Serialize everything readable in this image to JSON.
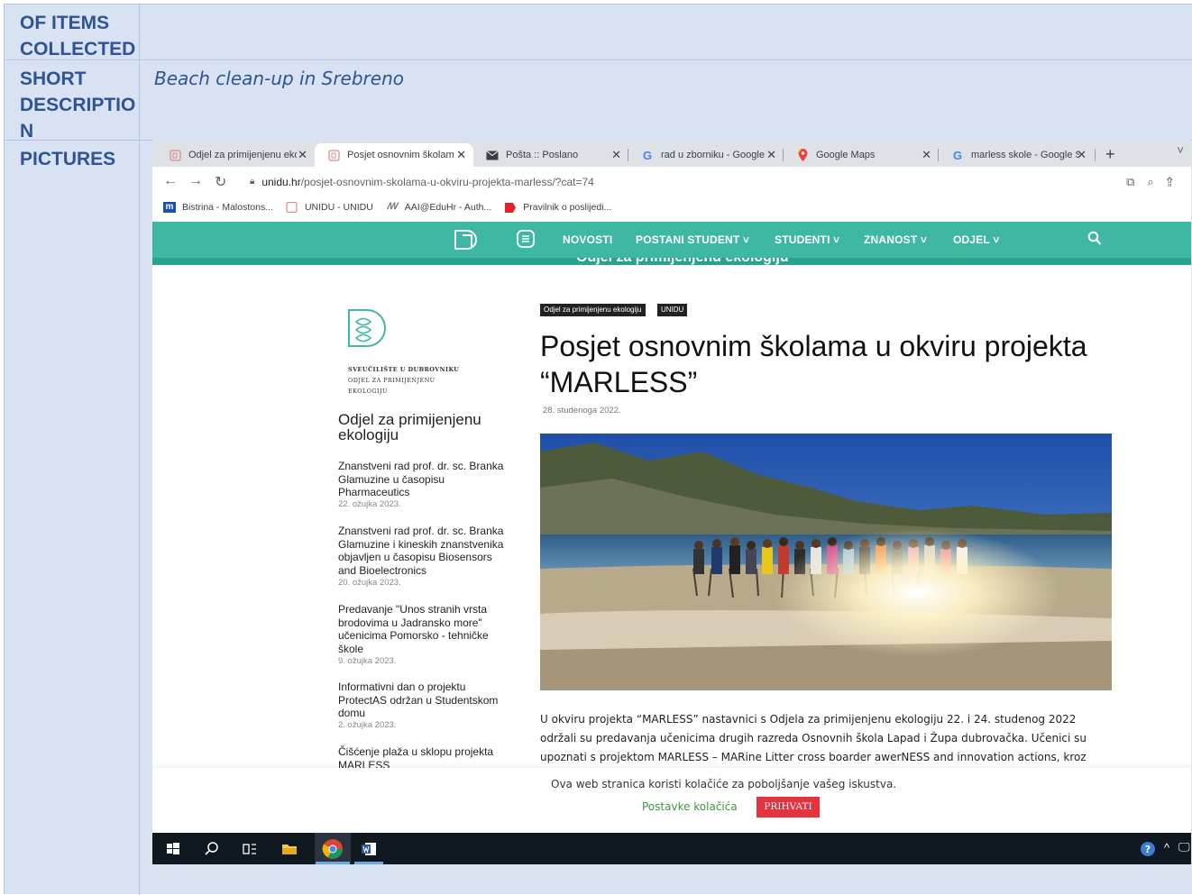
{
  "table": {
    "row1": {
      "label": "OF ITEMS COLLECTED",
      "value": ""
    },
    "row2": {
      "label": "SHORT DESCRIPTIO N",
      "value": "Beach clean-up in Srebreno"
    },
    "row3": {
      "label": "PICTURES"
    }
  },
  "browser": {
    "tabs": [
      {
        "title": "Odjel za primijenjenu eko",
        "icon": "unidu-icon"
      },
      {
        "title": "Posjet osnovnim školam",
        "icon": "unidu-icon",
        "active": true
      },
      {
        "title": "Pošta :: Poslano",
        "icon": "mail-icon"
      },
      {
        "title": "rad u zborniku - Google",
        "icon": "google-icon"
      },
      {
        "title": "Google Maps",
        "icon": "maps-icon"
      },
      {
        "title": "marless skole - Google S",
        "icon": "google-icon"
      }
    ],
    "url_host": "unidu.hr",
    "url_path": "/posjet-osnovnim-skolama-u-okviru-projekta-marless/?cat=74",
    "bookmarks": [
      {
        "label": "Bistrina - Malostons...",
        "icon": "bistrina-icon"
      },
      {
        "label": "UNIDU - UNIDU",
        "icon": "unidu-icon"
      },
      {
        "label": "AAI@EduHr - Auth...",
        "icon": "aai-icon"
      },
      {
        "label": "Pravilnik o poslijedi...",
        "icon": "pdf-icon"
      }
    ]
  },
  "site": {
    "menu": [
      "NOVOSTI",
      "POSTANI STUDENT ˅",
      "STUDENTI ˅",
      "ZNANOST ˅",
      "ODJEL ˅"
    ],
    "subbar_text": "Odjel za primijenjenu ekologiju",
    "institution": [
      "SVEUČILIŠTE U DUBROVNIKU",
      "ODJEL ZA PRIMIJENJENU",
      "EKOLOGIJU"
    ],
    "sidebar_heading": "Odjel za primijenjenu ekologiju",
    "sidebar_posts": [
      {
        "title": "Znanstveni rad prof. dr. sc. Branka Glamuzine u časopisu Pharmaceutics",
        "date": "22. ožujka 2023."
      },
      {
        "title": "Znanstveni rad prof. dr. sc. Branka Glamuzine i kineskih znanstvenika objavljen u časopisu Biosensors and Bioelectronics",
        "date": "20. ožujka 2023."
      },
      {
        "title": "Predavanje \"Unos stranih vrsta brodovima u Jadransko more\" učenicima Pomorsko - tehničke škole",
        "date": "9. ožujka 2023."
      },
      {
        "title": "Informativni dan o projektu ProtectAS održan u Studentskom domu",
        "date": "2. ožujka 2023."
      },
      {
        "title": "Čišćenje plaža u sklopu projekta MARLESS",
        "date": ""
      }
    ],
    "tags": [
      "Odjel za primijenjenu ekologiju",
      "UNIDU"
    ],
    "post_title": "Posjet osnovnim školama u okviru projekta “MARLESS”",
    "post_date": "28. studenoga 2022.",
    "post_lines": [
      "U okviru projekta “MARLESS” nastavnici s Odjela za primijenjenu  ekologiju 22. i 24. studenog 2022",
      "održali su predavanja učenicima drugih razreda Osnovnih škola Lapad i Župa dubrovačka. Učenici su",
      "upoznati s projektom MARLESS – MARine Litter cross boarder awerNESS and innovation actions, kroz"
    ],
    "cookie_text": "Ova web stranica koristi kolačiće za poboljšanje vašeg iskustva.",
    "cookie_settings": "Postavke kolačića",
    "cookie_accept": "PRIHVATI"
  },
  "colors": {
    "teal": "#3fb8a3",
    "table_bg": "#d9e2f3",
    "label": "#2f5496",
    "accept": "#e2333f"
  }
}
